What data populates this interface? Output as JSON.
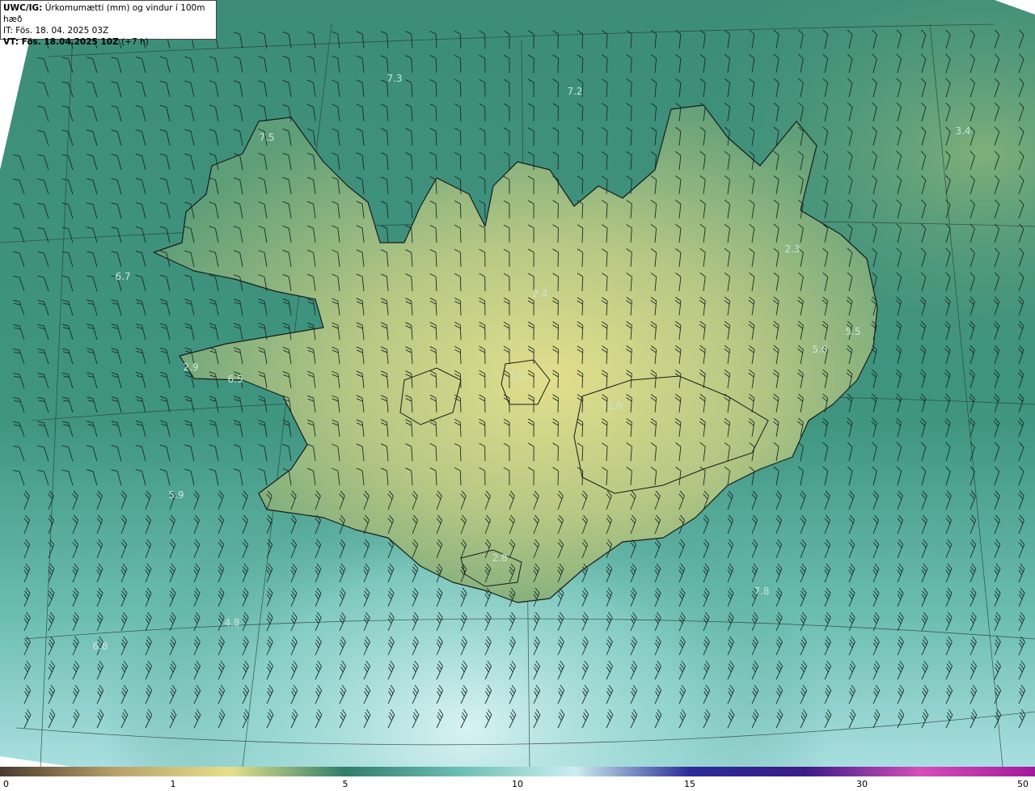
{
  "header": {
    "product_code": "UWC/IG:",
    "title": "Úrkomumætti (mm) og vindur í 100m hæð",
    "initial_time": "IT: Fös. 18. 04. 2025 03Z",
    "valid_label": "VT: Fös. 18.04.2025 10Z",
    "valid_offset": "(+7 h)"
  },
  "map_labels": [
    "7.3",
    "7.2",
    "3.4",
    "7.5",
    "6.7",
    "2.4",
    "2.3",
    "5.5",
    "2.9",
    "6.5",
    "1.0",
    "5.9",
    "2.8",
    "7.8",
    "4.8",
    "6.8",
    "5.0",
    "1.1"
  ],
  "colorbar": {
    "ticks": [
      "0",
      "1",
      "5",
      "10",
      "15",
      "30",
      "50"
    ],
    "colors": [
      "#4a3a2e",
      "#b7a16a",
      "#e6e08a",
      "#2f7e6a",
      "#6cbfb3",
      "#cdeef0",
      "#2a2c99",
      "#3b1b86",
      "#d54fb9",
      "#a21a9b"
    ]
  },
  "colors": {
    "sea": "#3f8f7a",
    "land_low": "#6fa67b",
    "land_high": "#d9d889",
    "coast": "#1a1a1a"
  }
}
